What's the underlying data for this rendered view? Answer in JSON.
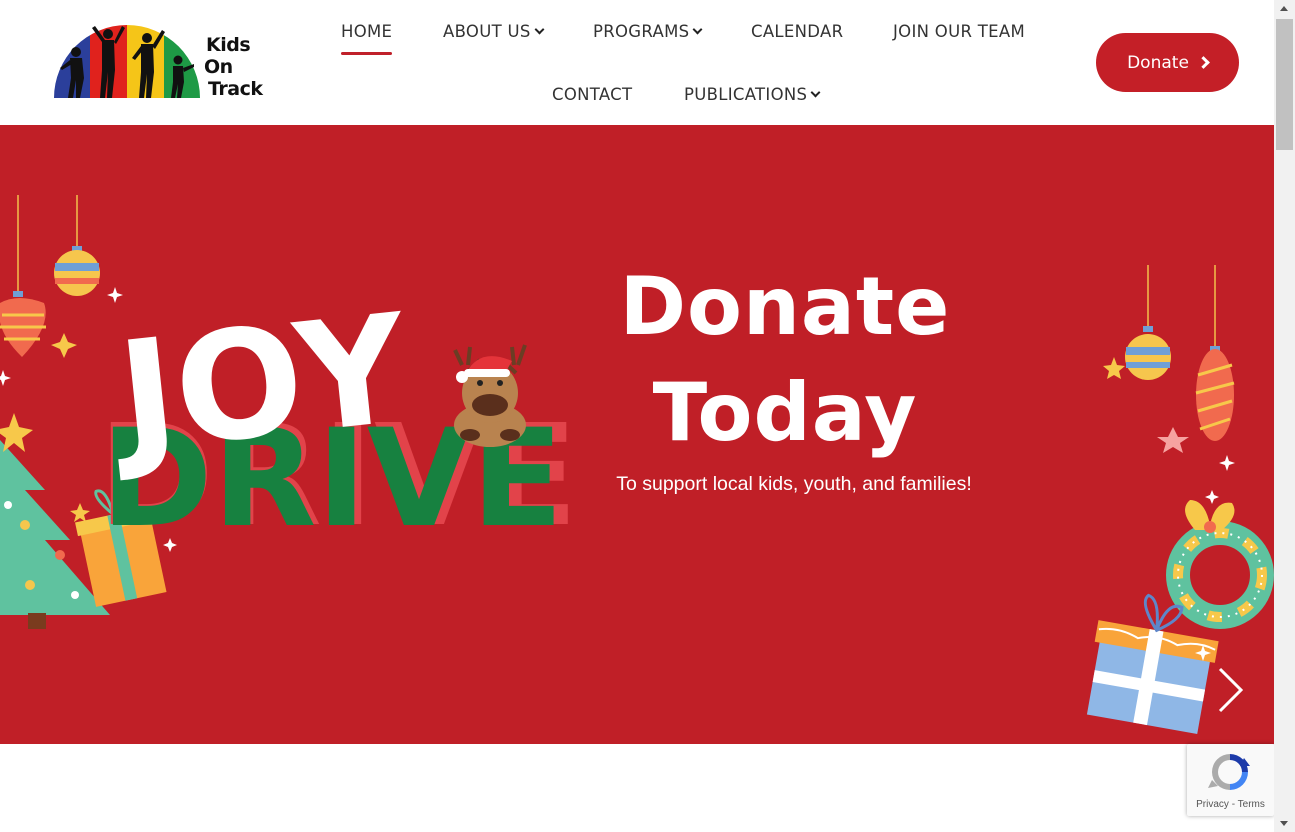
{
  "brand": {
    "line1": "Kids",
    "line2": "On",
    "line3": "Track",
    "colors": [
      "#2b3f9b",
      "#e0221d",
      "#f5c518",
      "#1e9a45"
    ]
  },
  "nav": {
    "home": "HOME",
    "about": "ABOUT US",
    "programs": "PROGRAMS",
    "calendar": "CALENDAR",
    "join": "JOIN OUR TEAM",
    "contact": "CONTACT",
    "publications": "PUBLICATIONS"
  },
  "header": {
    "donate_label": "Donate"
  },
  "hero": {
    "title_line1": "Donate",
    "title_line2": "Today",
    "subtitle": "To support local kids, youth, and families!",
    "art_word1": "JOY",
    "art_word2": "DRIVE",
    "background": "#c01f27"
  },
  "recaptcha": {
    "privacy": "Privacy",
    "terms": "Terms"
  },
  "accent_color": "#c41f27"
}
